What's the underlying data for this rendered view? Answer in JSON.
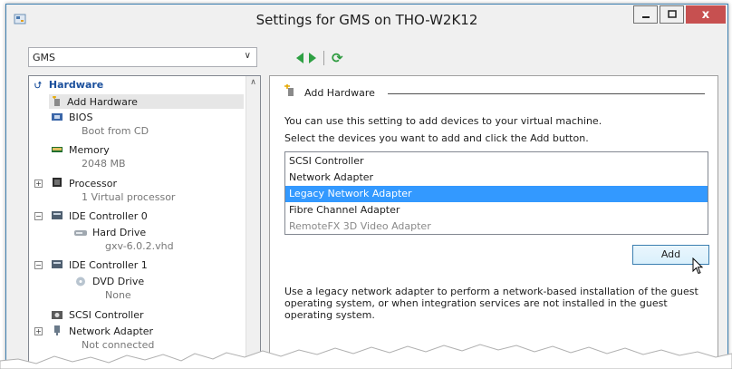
{
  "window": {
    "title": "Settings for GMS on THO-W2K12",
    "close_glyph": "x"
  },
  "vm_selector": {
    "value": "GMS"
  },
  "tree": {
    "header": "Hardware",
    "items": [
      {
        "label": "Add Hardware",
        "sub": ""
      },
      {
        "label": "BIOS",
        "sub": "Boot from CD"
      },
      {
        "label": "Memory",
        "sub": "2048 MB"
      },
      {
        "label": "Processor",
        "sub": "1 Virtual processor"
      },
      {
        "label": "IDE Controller 0",
        "sub": ""
      },
      {
        "label": "Hard Drive",
        "sub": "gxv-6.0.2.vhd"
      },
      {
        "label": "IDE Controller 1",
        "sub": ""
      },
      {
        "label": "DVD Drive",
        "sub": "None"
      },
      {
        "label": "SCSI Controller",
        "sub": ""
      },
      {
        "label": "Network Adapter",
        "sub": "Not connected"
      }
    ]
  },
  "main": {
    "section_title": "Add Hardware",
    "intro": "You can use this setting to add devices to your virtual machine.",
    "instruction": "Select the devices you want to add and click the Add button.",
    "devices": [
      {
        "label": "SCSI Controller",
        "state": "normal"
      },
      {
        "label": "Network Adapter",
        "state": "normal"
      },
      {
        "label": "Legacy Network Adapter",
        "state": "selected"
      },
      {
        "label": "Fibre Channel Adapter",
        "state": "normal"
      },
      {
        "label": "RemoteFX 3D Video Adapter",
        "state": "disabled"
      }
    ],
    "add_button": "Add",
    "help": "Use a legacy network adapter to perform a network-based installation of the guest operating system, or when integration services are not installed in the guest operating system."
  },
  "colors": {
    "selection": "#3399ff",
    "header_blue": "#1a4f9c",
    "close_red": "#c75050",
    "nav_green": "#2ea043"
  }
}
